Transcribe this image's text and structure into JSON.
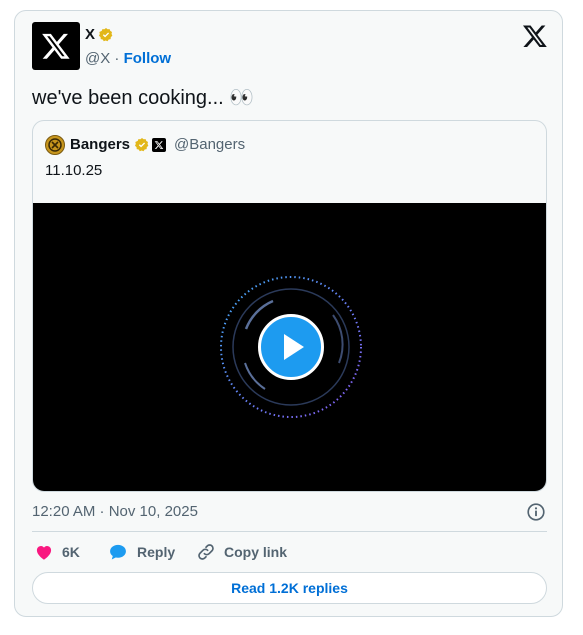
{
  "author": {
    "name": "X",
    "handle": "@X",
    "separator": "·",
    "follow_label": "Follow",
    "verified": true
  },
  "tweet": {
    "text": "we've been cooking... 👀"
  },
  "quote": {
    "name": "Bangers",
    "handle": "@Bangers",
    "text": "11.10.25",
    "verified": true,
    "affiliate_badge": "x-logo-badge"
  },
  "video": {
    "state": "paused",
    "background": "#000000"
  },
  "meta": {
    "timestamp": "12:20 AM · Nov 10, 2025"
  },
  "actions": {
    "likes_count": "6K",
    "reply_label": "Reply",
    "copy_link_label": "Copy link"
  },
  "replies_button": {
    "label": "Read 1.2K replies"
  },
  "colors": {
    "accent": "#1d9bf0",
    "link": "#006fd6",
    "like": "#f91880",
    "verified_gold": "#e2b719",
    "secondary_text": "#536471",
    "border": "#cfd9de"
  }
}
